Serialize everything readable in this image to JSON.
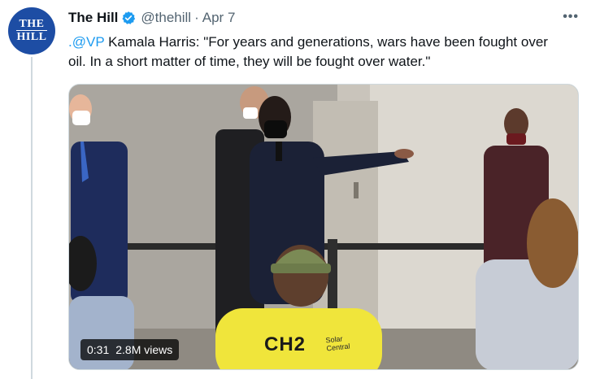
{
  "tweet": {
    "author_name": "The Hill",
    "handle": "@thehill",
    "separator": "·",
    "date": "Apr 7",
    "avatar_text_line1": "THE",
    "avatar_text_line2": "HILL",
    "mention": ".@VP",
    "text": " Kamala Harris: \"For years and generations, wars have been fought over oil. In a short matter of time, they will be fought over water.\"",
    "more_label": "•••"
  },
  "video": {
    "duration": "0:31",
    "views": "2.8M views",
    "shirt_text": "CH2",
    "shirt_small_line1": "Solar",
    "shirt_small_line2": "Central"
  },
  "icons": {
    "verified": "verified-badge-icon",
    "more": "more-options-icon"
  },
  "colors": {
    "brand_blue": "#1d4da4",
    "link_blue": "#1d9bf0",
    "secondary_text": "#536471"
  }
}
